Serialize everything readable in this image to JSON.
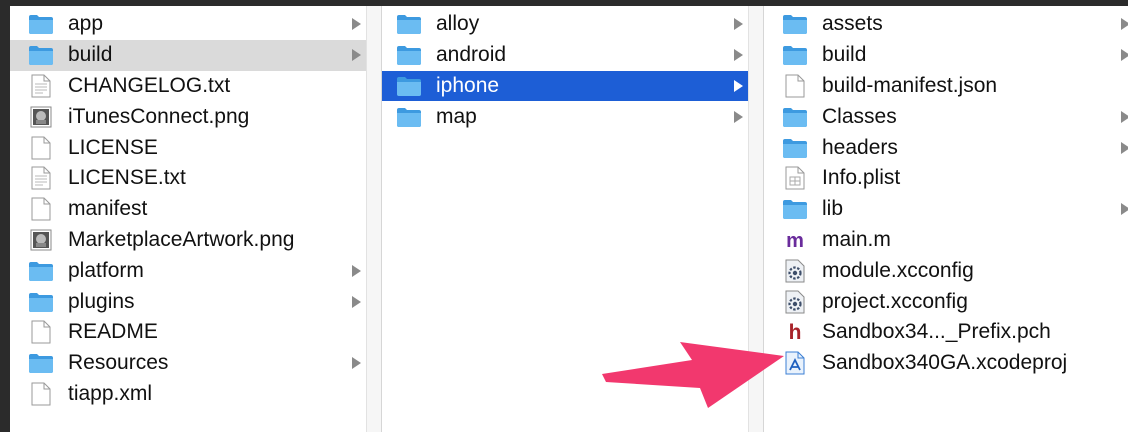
{
  "columns": [
    {
      "items": [
        {
          "label": "app",
          "icon": "folder-icon",
          "has_children": true,
          "selected": "none"
        },
        {
          "label": "build",
          "icon": "folder-icon",
          "has_children": true,
          "selected": "gray"
        },
        {
          "label": "CHANGELOG.txt",
          "icon": "text-file-icon",
          "has_children": false,
          "selected": "none"
        },
        {
          "label": "iTunesConnect.png",
          "icon": "image-file-icon",
          "has_children": false,
          "selected": "none"
        },
        {
          "label": "LICENSE",
          "icon": "blank-file-icon",
          "has_children": false,
          "selected": "none"
        },
        {
          "label": "LICENSE.txt",
          "icon": "text-file-icon",
          "has_children": false,
          "selected": "none"
        },
        {
          "label": "manifest",
          "icon": "blank-file-icon",
          "has_children": false,
          "selected": "none"
        },
        {
          "label": "MarketplaceArtwork.png",
          "icon": "image-file-icon",
          "has_children": false,
          "selected": "none"
        },
        {
          "label": "platform",
          "icon": "folder-icon",
          "has_children": true,
          "selected": "none"
        },
        {
          "label": "plugins",
          "icon": "folder-icon",
          "has_children": true,
          "selected": "none"
        },
        {
          "label": "README",
          "icon": "blank-file-icon",
          "has_children": false,
          "selected": "none"
        },
        {
          "label": "Resources",
          "icon": "folder-icon",
          "has_children": true,
          "selected": "none"
        },
        {
          "label": "tiapp.xml",
          "icon": "blank-file-icon",
          "has_children": false,
          "selected": "none"
        }
      ]
    },
    {
      "items": [
        {
          "label": "alloy",
          "icon": "folder-icon",
          "has_children": true,
          "selected": "none"
        },
        {
          "label": "android",
          "icon": "folder-icon",
          "has_children": true,
          "selected": "none"
        },
        {
          "label": "iphone",
          "icon": "folder-icon",
          "has_children": true,
          "selected": "blue"
        },
        {
          "label": "map",
          "icon": "folder-icon",
          "has_children": true,
          "selected": "none"
        }
      ]
    },
    {
      "items": [
        {
          "label": "assets",
          "icon": "folder-icon",
          "has_children": true,
          "selected": "none"
        },
        {
          "label": "build",
          "icon": "folder-icon",
          "has_children": true,
          "selected": "none"
        },
        {
          "label": "build-manifest.json",
          "icon": "blank-file-icon",
          "has_children": false,
          "selected": "none"
        },
        {
          "label": "Classes",
          "icon": "folder-icon",
          "has_children": true,
          "selected": "none"
        },
        {
          "label": "headers",
          "icon": "folder-icon",
          "has_children": true,
          "selected": "none"
        },
        {
          "label": "Info.plist",
          "icon": "plist-file-icon",
          "has_children": false,
          "selected": "none"
        },
        {
          "label": "lib",
          "icon": "folder-icon",
          "has_children": true,
          "selected": "none"
        },
        {
          "label": "main.m",
          "icon": "objc-m-file-icon",
          "has_children": false,
          "selected": "none"
        },
        {
          "label": "module.xcconfig",
          "icon": "xcconfig-file-icon",
          "has_children": false,
          "selected": "none"
        },
        {
          "label": "project.xcconfig",
          "icon": "xcconfig-file-icon",
          "has_children": false,
          "selected": "none"
        },
        {
          "label": "Sandbox34..._Prefix.pch",
          "icon": "header-h-file-icon",
          "has_children": false,
          "selected": "none"
        },
        {
          "label": "Sandbox340GA.xcodeproj",
          "icon": "xcodeproj-file-icon",
          "has_children": false,
          "selected": "none"
        }
      ]
    }
  ],
  "colors": {
    "selection_blue": "#1d5ed6",
    "selection_gray": "#dadada",
    "folder_blue": "#4aa8e8",
    "annotation_arrow": "#f2386e"
  },
  "annotation": {
    "icon": "arrow-icon",
    "points_to": "Sandbox340GA.xcodeproj"
  }
}
